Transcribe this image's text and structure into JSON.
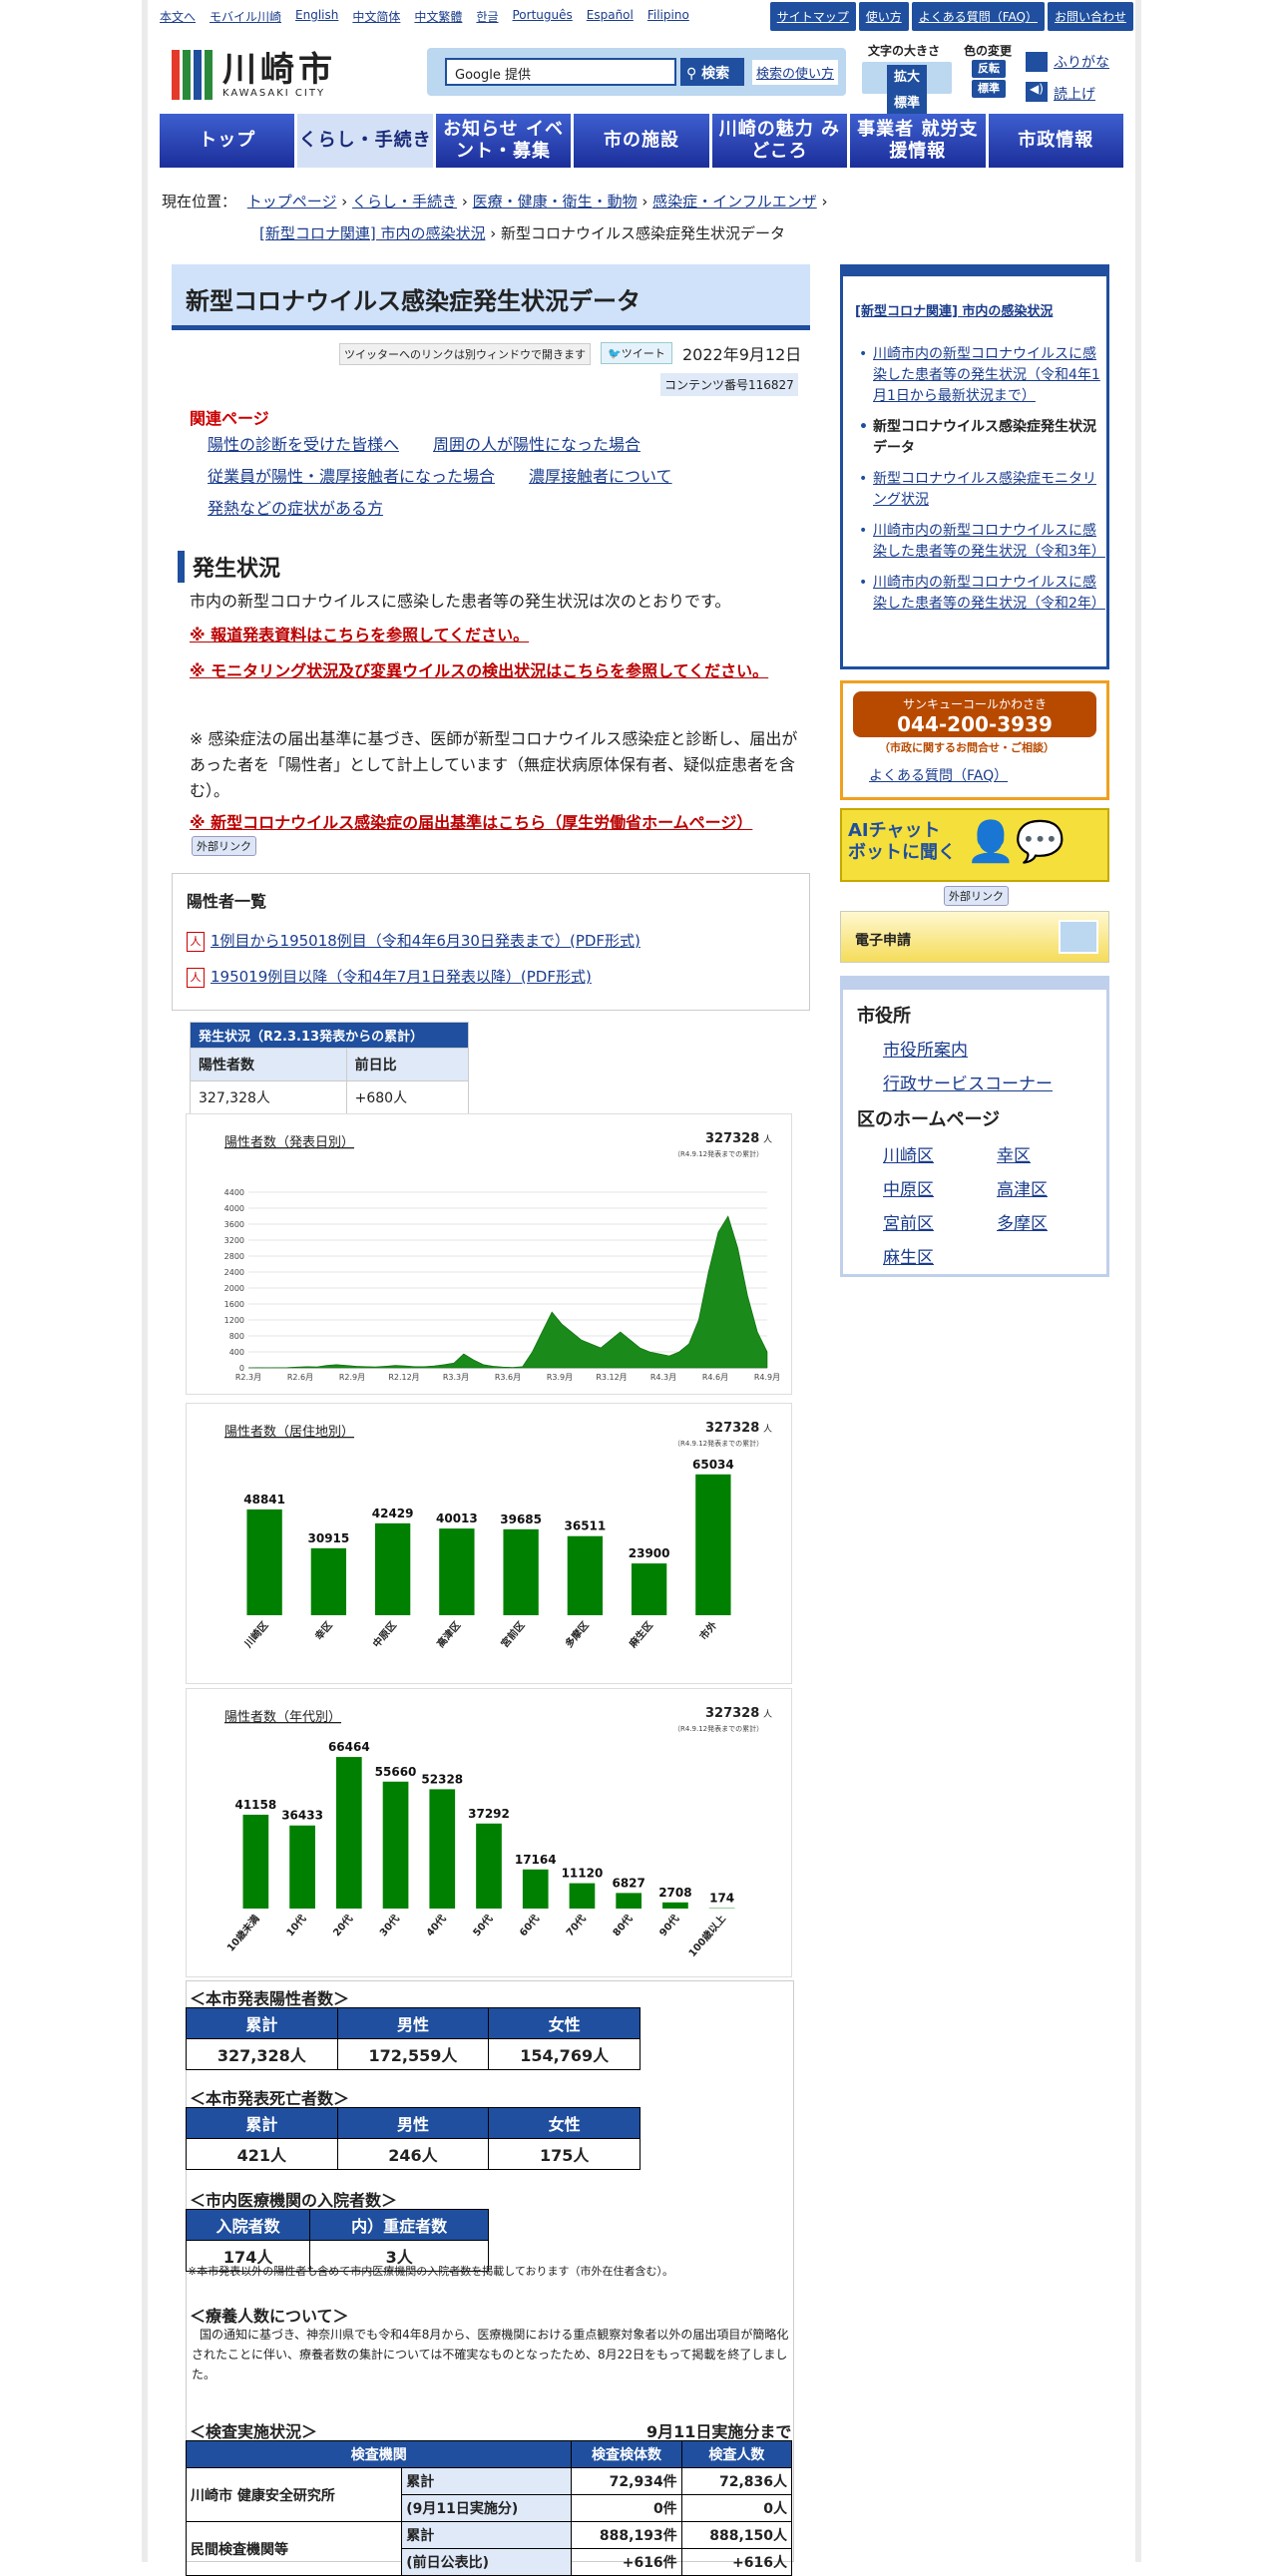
{
  "util_links": [
    "本文へ",
    "モバイル川崎",
    "English",
    "中文简体",
    "中文繁體",
    "한글",
    "Português",
    "Español",
    "Filipino"
  ],
  "util_right": [
    "サイトマップ",
    "使い方",
    "よくある質問（FAQ）",
    "お問い合わせ"
  ],
  "logo": {
    "title": "川崎市",
    "sub": "KAWASAKI CITY",
    "colors": [
      "#e53a2a",
      "#2a8a3a",
      "#1f4f9e",
      "#2a8a3a"
    ]
  },
  "search": {
    "placeholder": "Google 提供",
    "button": "検索",
    "how": "検索の使い方"
  },
  "header": {
    "font_size_label": "文字の大きさ",
    "font_up": "拡大",
    "font_std": "標準",
    "color_label": "色の変更",
    "color_inv": "反転",
    "color_std": "標準",
    "furigana": "ふりがな",
    "yomiage": "読上げ"
  },
  "nav": [
    "トップ",
    "くらし・手続き",
    "お知らせ イベント・募集",
    "市の施設",
    "川崎の魅力 みどころ",
    "事業者 就労支援情報",
    "市政情報"
  ],
  "breadcrumb": {
    "label": "現在位置：",
    "items": [
      "トップページ",
      "くらし・手続き",
      "医療・健康・衛生・動物",
      "感染症・インフルエンザ",
      "[新型コロナ関連] 市内の感染状況"
    ],
    "current": "新型コロナウイルス感染症発生状況データ"
  },
  "page": {
    "title": "新型コロナウイルス感染症発生状況データ",
    "twitter_note": "ツイッターへのリンクは別ウィンドウで開きます",
    "tweet": "ツイート",
    "date": "2022年9月12日",
    "content_no": "コンテンツ番号116827"
  },
  "related": {
    "heading": "関連ページ",
    "links": [
      "陽性の診断を受けた皆様へ",
      "周囲の人が陽性になった場合",
      "従業員が陽性・濃厚接触者になった場合",
      "濃厚接触者について",
      "発熱などの症状がある方"
    ]
  },
  "section": {
    "heading": "発生状況",
    "intro": "市内の新型コロナウイルスに感染した患者等の発生状況は次のとおりです。",
    "press": "※ 報道発表資料はこちらを参照してください。",
    "monitor": "※ モニタリング状況及び変異ウイルスの検出状況はこちらを参照してください。",
    "note": "※ 感染症法の届出基準に基づき、医師が新型コロナウイルス感染症と診断し、届出があった者を「陽性者」として計上しています（無症状病原体保有者、疑似症患者を含む）。",
    "criteria": "※ 新型コロナウイルス感染症の届出基準はこちら（厚生労働省ホームページ）",
    "ext": "外部リンク"
  },
  "list": {
    "heading": "陽性者一覧",
    "items": [
      "1例目から195018例目（令和4年6月30日発表まで）(PDF形式)",
      "195019例目以降（令和4年7月1日発表以降）(PDF形式)"
    ]
  },
  "cumulative": {
    "caption": "発生状況（R2.3.13発表からの累計）",
    "h1": "陽性者数",
    "h2": "前日比",
    "v1": "327,328人",
    "v2": "+680人"
  },
  "chart_data": [
    {
      "type": "area",
      "title": "陽性者数（発表日別）",
      "total": "327328",
      "unit": "人",
      "note": "（R4.9.12発表までの累計）",
      "x": [
        "R2.3月",
        "R2.6月",
        "R2.9月",
        "R2.12月",
        "R3.3月",
        "R3.6月",
        "R3.9月",
        "R3.12月",
        "R4.3月",
        "R4.6月",
        "R4.9月"
      ],
      "yticks": [
        0,
        400,
        800,
        1200,
        1600,
        2000,
        2400,
        2800,
        3200,
        3600,
        4000,
        4400
      ],
      "ylim": [
        0,
        4400
      ],
      "profile": [
        0,
        5,
        3,
        5,
        8,
        20,
        30,
        25,
        60,
        80,
        60,
        40,
        30,
        25,
        40,
        60,
        50,
        30,
        30,
        50,
        80,
        120,
        350,
        200,
        80,
        40,
        20,
        10,
        30,
        400,
        900,
        1400,
        1100,
        900,
        700,
        600,
        500,
        700,
        900,
        700,
        500,
        400,
        350,
        300,
        400,
        600,
        1200,
        2400,
        3400,
        3800,
        3000,
        1800,
        900,
        400
      ]
    },
    {
      "type": "bar",
      "title": "陽性者数（居住地別）",
      "total": "327328",
      "unit": "人",
      "note": "（R4.9.12発表までの累計）",
      "categories": [
        "川崎区",
        "幸区",
        "中原区",
        "高津区",
        "宮前区",
        "多摩区",
        "麻生区",
        "市外"
      ],
      "values": [
        48841,
        30915,
        42429,
        40013,
        39685,
        36511,
        23900,
        65034
      ],
      "ylim": [
        0,
        70000
      ],
      "color": "#008000"
    },
    {
      "type": "bar",
      "title": "陽性者数（年代別）",
      "total": "327328",
      "unit": "人",
      "note": "（R4.9.12発表までの累計）",
      "categories": [
        "10歳未満",
        "10代",
        "20代",
        "30代",
        "40代",
        "50代",
        "60代",
        "70代",
        "80代",
        "90代",
        "100歳以上"
      ],
      "values": [
        41158,
        36433,
        66464,
        55660,
        52328,
        37292,
        17164,
        11120,
        6827,
        2708,
        174
      ],
      "ylim": [
        0,
        70000
      ],
      "color": "#008000"
    }
  ],
  "positives": {
    "heading": "＜本市発表陽性者数＞",
    "headers": [
      "累計",
      "男性",
      "女性"
    ],
    "values": [
      "327,328人",
      "172,559人",
      "154,769人"
    ]
  },
  "deaths": {
    "heading": "＜本市発表死亡者数＞",
    "headers": [
      "累計",
      "男性",
      "女性"
    ],
    "values": [
      "421人",
      "246人",
      "175人"
    ]
  },
  "hosp": {
    "heading": "＜市内医療機関の入院者数＞",
    "headers": [
      "入院者数",
      "内）重症者数"
    ],
    "values": [
      "174人",
      "3人"
    ],
    "note": "※本市発表以外の陽性者も含めて市内医療機関の入院者数を掲載しております（市外在住者含む）。"
  },
  "ryoyo": {
    "heading": "＜療養人数について＞",
    "text": "国の通知に基づき、神奈川県でも令和4年8月から、医療機関における重点観察対象者以外の届出項目が簡略化されたことに伴い、療養者数の集計については不確実なものとなったため、8月22日をもって掲載を終了しました。"
  },
  "tests": {
    "heading": "＜検査実施状況＞",
    "date": "9月11日実施分まで",
    "headers": [
      "検査機関",
      "検査検体数",
      "検査人数"
    ],
    "rows": [
      {
        "org": "川崎市 健康安全研究所",
        "sub": "累計",
        "a": "72,934件",
        "b": "72,836人"
      },
      {
        "org": "",
        "sub": "(9月11日実施分)",
        "a": "0件",
        "b": "0人"
      },
      {
        "org": "民間検査機関等",
        "sub": "累計",
        "a": "888,193件",
        "b": "888,150人"
      },
      {
        "org": "",
        "sub": "(前日公表比)",
        "a": "+616件",
        "b": "+616人"
      }
    ]
  },
  "side": {
    "heading": "[新型コロナ関連] 市内の感染状況",
    "items": [
      "川崎市内の新型コロナウイルスに感染した患者等の発生状況（令和4年1月1日から最新状況まで）",
      "新型コロナウイルス感染症発生状況データ",
      "新型コロナウイルス感染症モニタリング状況",
      "川崎市内の新型コロナウイルスに感染した患者等の発生状況（令和3年）",
      "川崎市内の新型コロナウイルスに感染した患者等の発生状況（令和2年）"
    ]
  },
  "callcenter": {
    "name": "サンキューコールかわさき",
    "tel": "044-200-3939",
    "sub": "（市政に関するお問合せ・ご相談）",
    "faq": "よくある質問（FAQ）"
  },
  "ai": {
    "text": "AIチャットボットに聞く",
    "ext": "外部リンク"
  },
  "eapp": {
    "text": "電子申請"
  },
  "ward": {
    "city_heading": "市役所",
    "city_links": [
      "市役所案内",
      "行政サービスコーナー"
    ],
    "ward_heading": "区のホームページ",
    "wards": [
      "川崎区",
      "幸区",
      "中原区",
      "高津区",
      "宮前区",
      "多摩区",
      "麻生区"
    ]
  }
}
